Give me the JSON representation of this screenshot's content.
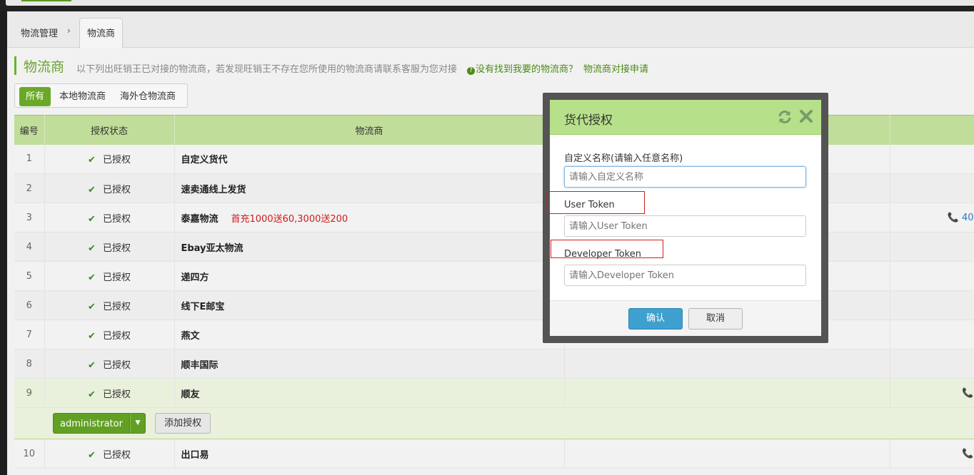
{
  "breadcrumb": {
    "root": "物流管理",
    "sep": "›",
    "current_tab": "物流商"
  },
  "header": {
    "title": "物流商",
    "description": "以下列出旺销王已对接的物流商，若发现旺销王不存在您所使用的物流商请联系客服为您对接",
    "question_link": "没有找到我要的物流商？",
    "apply_link": "物流商对接申请"
  },
  "filters": [
    "所有",
    "本地物流商",
    "海外仓物流商"
  ],
  "table": {
    "columns": [
      "编号",
      "授权状态",
      "物流商",
      "",
      ""
    ],
    "rows": [
      {
        "no": "1",
        "status": "已授权",
        "name": "自定义货代",
        "promo": "",
        "phone": ""
      },
      {
        "no": "2",
        "status": "已授权",
        "name": "速卖通线上发货",
        "promo": "",
        "phone": ""
      },
      {
        "no": "3",
        "status": "已授权",
        "name": "泰嘉物流",
        "promo": "首充1000送60,3000送200",
        "phone": "📞 40"
      },
      {
        "no": "4",
        "status": "已授权",
        "name": "Ebay亚太物流",
        "promo": "",
        "phone": ""
      },
      {
        "no": "5",
        "status": "已授权",
        "name": "递四方",
        "promo": "",
        "phone": ""
      },
      {
        "no": "6",
        "status": "已授权",
        "name": "线下E邮宝",
        "promo": "",
        "phone": ""
      },
      {
        "no": "7",
        "status": "已授权",
        "name": "燕文",
        "promo": "",
        "phone": ""
      },
      {
        "no": "8",
        "status": "已授权",
        "name": "顺丰国际",
        "promo": "",
        "phone": ""
      },
      {
        "no": "9",
        "status": "已授权",
        "name": "顺友",
        "promo": "",
        "phone": "📞"
      },
      {
        "no": "10",
        "status": "已授权",
        "name": "出口易",
        "promo": "",
        "phone": "📞"
      }
    ],
    "sub_row": {
      "account": "administrator",
      "add_button": "添加授权"
    }
  },
  "modal": {
    "title": "货代授权",
    "fields": [
      {
        "label": "自定义名称(请输入任意名称)",
        "placeholder": "请输入自定义名称"
      },
      {
        "label": "User Token",
        "placeholder": "请输入User Token"
      },
      {
        "label": "Developer Token",
        "placeholder": "请输入Developer Token"
      }
    ],
    "confirm": "确认",
    "cancel": "取消"
  },
  "colors": {
    "accent_green": "#6aa928",
    "header_green": "#c0dd9a",
    "modal_header": "#b7e08a",
    "primary_blue": "#3da0cf",
    "promo_red": "#d21a1a"
  },
  "icons": [
    "chevron-right-icon",
    "question-icon",
    "check-icon",
    "phone-icon",
    "refresh-icon",
    "close-icon",
    "caret-down-icon"
  ]
}
